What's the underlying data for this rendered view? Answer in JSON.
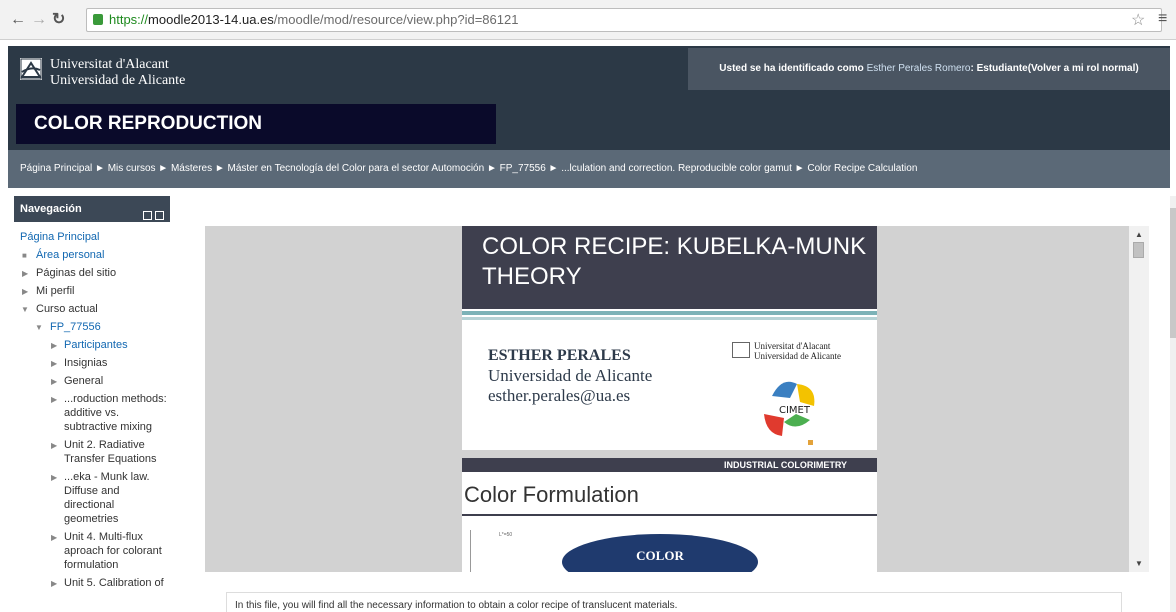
{
  "browser": {
    "url_scheme": "https://",
    "url_host": "moodle2013-14.ua.es",
    "url_path": "/moodle/mod/resource/view.php?id=86121"
  },
  "header": {
    "logo_line1": "Universitat d'Alacant",
    "logo_line2": "Universidad de Alicante",
    "user_prefix": "Usted se ha identificado como ",
    "user_name": "Esther Perales Romero",
    "user_suffix": ": Estudiante(Volver a mi rol normal)",
    "course_title": "COLOR REPRODUCTION"
  },
  "breadcrumb": "Página Principal ► Mis cursos ► Másteres ► Máster en Tecnología del Color para el sector Automoción ► FP_77556 ► ...lculation and correction. Reproducible color gamut ► Color Recipe Calculation",
  "sidebar": {
    "title": "Navegación",
    "items": [
      {
        "label": "Página Principal"
      },
      {
        "label": "Área personal"
      },
      {
        "label": "Páginas del sitio"
      },
      {
        "label": "Mi perfil"
      },
      {
        "label": "Curso actual"
      },
      {
        "label": "FP_77556"
      },
      {
        "label": "Participantes"
      },
      {
        "label": "Insignias"
      },
      {
        "label": "General"
      },
      {
        "label": "...roduction methods: additive vs. subtractive mixing"
      },
      {
        "label": "Unit 2. Radiative Transfer Equations"
      },
      {
        "label": "...eka - Munk law. Diffuse and directional geometries"
      },
      {
        "label": "Unit 4. Multi-flux aproach for colorant formulation"
      },
      {
        "label": "Unit 5. Calibration of"
      }
    ]
  },
  "slide1": {
    "title": "COLOR RECIPE: KUBELKA-MUNK THEORY",
    "author": "ESTHER PERALES",
    "affiliation": "Universidad de Alicante",
    "email": "esther.perales@ua.es",
    "uni_line1": "Universitat d'Alacant",
    "uni_line2": "Universidad de Alicante",
    "cimet_label": "CIMET"
  },
  "slide2": {
    "bar_label": "INDUSTRIAL COLORIMETRY",
    "title": "Color Formulation",
    "ellipse_label": "COLOR",
    "chart_label": "L*=50"
  },
  "description": "In this file, you will find all the necessary information to obtain a color recipe of translucent materials."
}
